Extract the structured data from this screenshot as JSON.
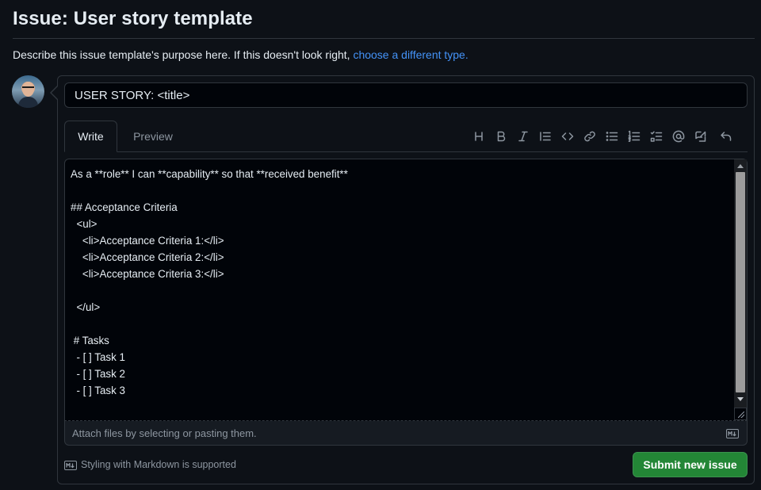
{
  "page": {
    "title": "Issue: User story template",
    "description_prefix": "Describe this issue template's purpose here. If this doesn't look right, ",
    "description_link": "choose a different type."
  },
  "form": {
    "title_value": "USER STORY: <title>",
    "tabs": [
      {
        "label": "Write",
        "active": true
      },
      {
        "label": "Preview",
        "active": false
      }
    ],
    "toolbar_icons": [
      "heading-icon",
      "bold-icon",
      "italic-icon",
      "quote-icon",
      "code-icon",
      "link-icon",
      "unordered-list-icon",
      "ordered-list-icon",
      "task-list-icon",
      "mention-icon",
      "reference-icon",
      "undo-icon"
    ],
    "body": "As a **role** I can **capability** so that **received benefit**\n\n## Acceptance Criteria\n  <ul>\n    <li>Acceptance Criteria 1:</li>\n    <li>Acceptance Criteria 2:</li>\n    <li>Acceptance Criteria 3:</li>\n\n  </ul>\n\n # Tasks\n  - [ ] Task 1\n  - [ ] Task 2\n  - [ ] Task 3",
    "attach_hint": "Attach files by selecting or pasting them.",
    "markdown_note": "Styling with Markdown is supported",
    "submit_label": "Submit new issue"
  },
  "colors": {
    "background": "#0d1117",
    "link": "#4493f8",
    "submit": "#238636",
    "muted_text": "#8d96a0"
  }
}
